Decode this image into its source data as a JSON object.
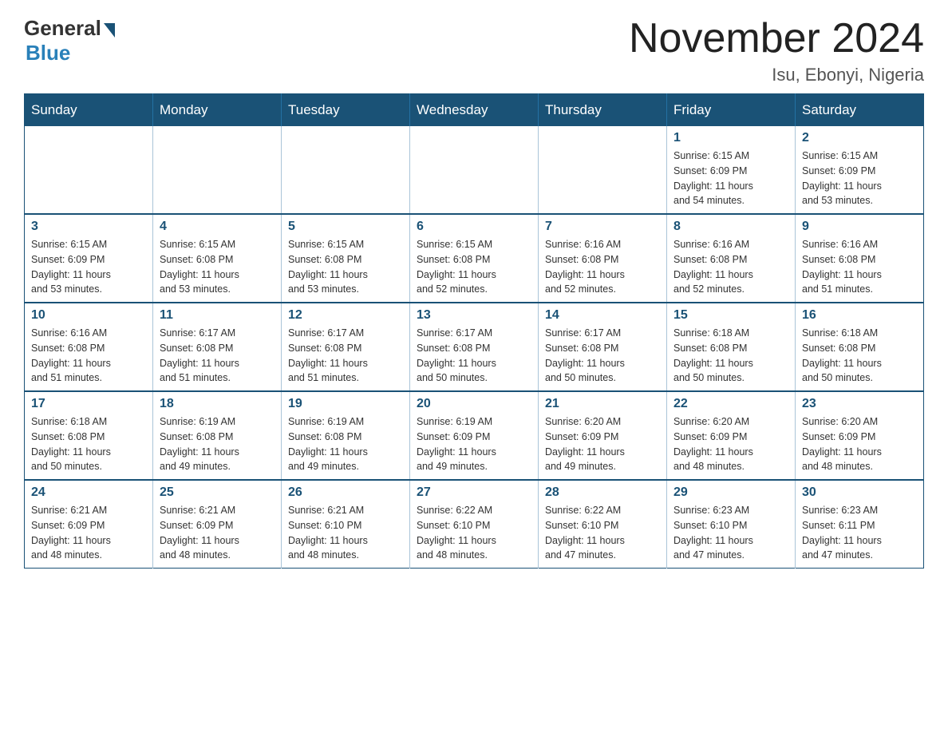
{
  "logo": {
    "general": "General",
    "blue": "Blue"
  },
  "title": "November 2024",
  "subtitle": "Isu, Ebonyi, Nigeria",
  "weekdays": [
    "Sunday",
    "Monday",
    "Tuesday",
    "Wednesday",
    "Thursday",
    "Friday",
    "Saturday"
  ],
  "weeks": [
    [
      {
        "day": "",
        "info": ""
      },
      {
        "day": "",
        "info": ""
      },
      {
        "day": "",
        "info": ""
      },
      {
        "day": "",
        "info": ""
      },
      {
        "day": "",
        "info": ""
      },
      {
        "day": "1",
        "info": "Sunrise: 6:15 AM\nSunset: 6:09 PM\nDaylight: 11 hours\nand 54 minutes."
      },
      {
        "day": "2",
        "info": "Sunrise: 6:15 AM\nSunset: 6:09 PM\nDaylight: 11 hours\nand 53 minutes."
      }
    ],
    [
      {
        "day": "3",
        "info": "Sunrise: 6:15 AM\nSunset: 6:09 PM\nDaylight: 11 hours\nand 53 minutes."
      },
      {
        "day": "4",
        "info": "Sunrise: 6:15 AM\nSunset: 6:08 PM\nDaylight: 11 hours\nand 53 minutes."
      },
      {
        "day": "5",
        "info": "Sunrise: 6:15 AM\nSunset: 6:08 PM\nDaylight: 11 hours\nand 53 minutes."
      },
      {
        "day": "6",
        "info": "Sunrise: 6:15 AM\nSunset: 6:08 PM\nDaylight: 11 hours\nand 52 minutes."
      },
      {
        "day": "7",
        "info": "Sunrise: 6:16 AM\nSunset: 6:08 PM\nDaylight: 11 hours\nand 52 minutes."
      },
      {
        "day": "8",
        "info": "Sunrise: 6:16 AM\nSunset: 6:08 PM\nDaylight: 11 hours\nand 52 minutes."
      },
      {
        "day": "9",
        "info": "Sunrise: 6:16 AM\nSunset: 6:08 PM\nDaylight: 11 hours\nand 51 minutes."
      }
    ],
    [
      {
        "day": "10",
        "info": "Sunrise: 6:16 AM\nSunset: 6:08 PM\nDaylight: 11 hours\nand 51 minutes."
      },
      {
        "day": "11",
        "info": "Sunrise: 6:17 AM\nSunset: 6:08 PM\nDaylight: 11 hours\nand 51 minutes."
      },
      {
        "day": "12",
        "info": "Sunrise: 6:17 AM\nSunset: 6:08 PM\nDaylight: 11 hours\nand 51 minutes."
      },
      {
        "day": "13",
        "info": "Sunrise: 6:17 AM\nSunset: 6:08 PM\nDaylight: 11 hours\nand 50 minutes."
      },
      {
        "day": "14",
        "info": "Sunrise: 6:17 AM\nSunset: 6:08 PM\nDaylight: 11 hours\nand 50 minutes."
      },
      {
        "day": "15",
        "info": "Sunrise: 6:18 AM\nSunset: 6:08 PM\nDaylight: 11 hours\nand 50 minutes."
      },
      {
        "day": "16",
        "info": "Sunrise: 6:18 AM\nSunset: 6:08 PM\nDaylight: 11 hours\nand 50 minutes."
      }
    ],
    [
      {
        "day": "17",
        "info": "Sunrise: 6:18 AM\nSunset: 6:08 PM\nDaylight: 11 hours\nand 50 minutes."
      },
      {
        "day": "18",
        "info": "Sunrise: 6:19 AM\nSunset: 6:08 PM\nDaylight: 11 hours\nand 49 minutes."
      },
      {
        "day": "19",
        "info": "Sunrise: 6:19 AM\nSunset: 6:08 PM\nDaylight: 11 hours\nand 49 minutes."
      },
      {
        "day": "20",
        "info": "Sunrise: 6:19 AM\nSunset: 6:09 PM\nDaylight: 11 hours\nand 49 minutes."
      },
      {
        "day": "21",
        "info": "Sunrise: 6:20 AM\nSunset: 6:09 PM\nDaylight: 11 hours\nand 49 minutes."
      },
      {
        "day": "22",
        "info": "Sunrise: 6:20 AM\nSunset: 6:09 PM\nDaylight: 11 hours\nand 48 minutes."
      },
      {
        "day": "23",
        "info": "Sunrise: 6:20 AM\nSunset: 6:09 PM\nDaylight: 11 hours\nand 48 minutes."
      }
    ],
    [
      {
        "day": "24",
        "info": "Sunrise: 6:21 AM\nSunset: 6:09 PM\nDaylight: 11 hours\nand 48 minutes."
      },
      {
        "day": "25",
        "info": "Sunrise: 6:21 AM\nSunset: 6:09 PM\nDaylight: 11 hours\nand 48 minutes."
      },
      {
        "day": "26",
        "info": "Sunrise: 6:21 AM\nSunset: 6:10 PM\nDaylight: 11 hours\nand 48 minutes."
      },
      {
        "day": "27",
        "info": "Sunrise: 6:22 AM\nSunset: 6:10 PM\nDaylight: 11 hours\nand 48 minutes."
      },
      {
        "day": "28",
        "info": "Sunrise: 6:22 AM\nSunset: 6:10 PM\nDaylight: 11 hours\nand 47 minutes."
      },
      {
        "day": "29",
        "info": "Sunrise: 6:23 AM\nSunset: 6:10 PM\nDaylight: 11 hours\nand 47 minutes."
      },
      {
        "day": "30",
        "info": "Sunrise: 6:23 AM\nSunset: 6:11 PM\nDaylight: 11 hours\nand 47 minutes."
      }
    ]
  ]
}
